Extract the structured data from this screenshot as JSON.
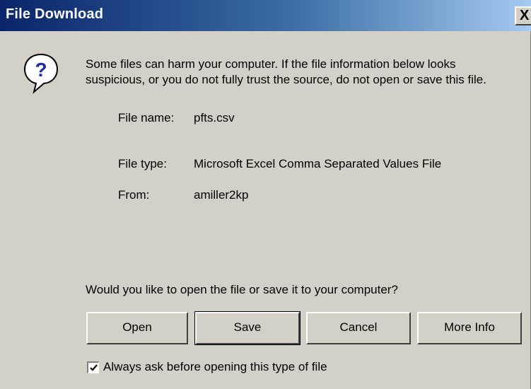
{
  "window": {
    "title": "File Download",
    "close_glyph": "X"
  },
  "message": {
    "icon": "question-icon",
    "warning": "Some files can harm your computer. If the file information below looks suspicious, or you do not fully trust the source, do not open or save this file.",
    "question": "Would you like to open the file or save it to your computer?"
  },
  "file_info": {
    "name_label": "File name:",
    "name_value": "pfts.csv",
    "type_label": "File type:",
    "type_value": "Microsoft Excel Comma Separated Values File",
    "from_label": "From:",
    "from_value": "amiller2kp"
  },
  "buttons": {
    "open": "Open",
    "save": "Save",
    "cancel": "Cancel",
    "more_info": "More Info"
  },
  "checkbox": {
    "checked": true,
    "label": "Always ask before opening this type of file"
  },
  "colors": {
    "dialog_bg": "#d4d0c8",
    "title_start": "#0a246a",
    "title_end": "#a6caf0",
    "icon_blue": "#1c2ea0"
  }
}
